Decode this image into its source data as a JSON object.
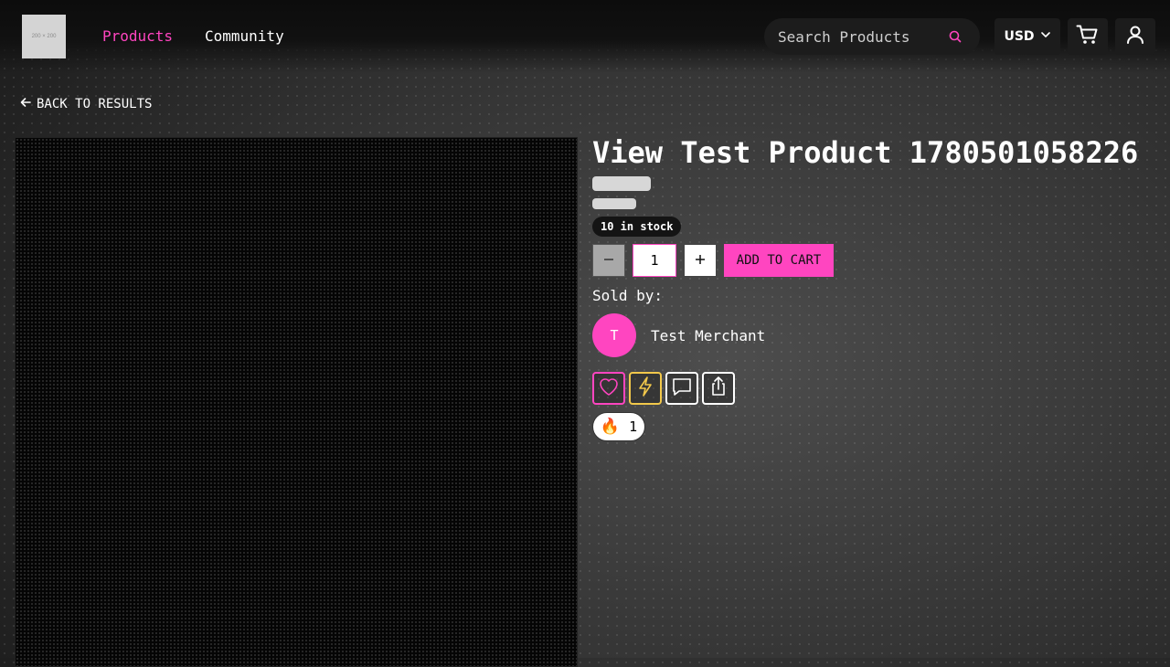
{
  "header": {
    "logo_text": "200 × 200",
    "nav": [
      {
        "label": "Products",
        "active": true
      },
      {
        "label": "Community",
        "active": false
      }
    ],
    "search": {
      "placeholder": "Search Products",
      "value": ""
    },
    "currency": "USD",
    "icons": {
      "search": "search-icon",
      "currency_caret": "chevron-down-icon",
      "cart": "cart-icon",
      "user": "user-icon"
    }
  },
  "back_link": {
    "label": "BACK TO RESULTS",
    "icon": "arrow-left-icon"
  },
  "product": {
    "title": "View Test Product 1780501058226",
    "stock_badge": "10 in stock",
    "quantity": "1",
    "add_to_cart_label": "ADD TO CART",
    "sold_by_label": "Sold by:",
    "merchant_initial": "T",
    "merchant_name": "Test Merchant",
    "reaction": {
      "emoji": "🔥",
      "count": "1"
    },
    "actions": [
      "heart-icon",
      "lightning-icon",
      "comment-icon",
      "share-icon"
    ]
  },
  "colors": {
    "accent": "#ff45c0",
    "boost": "#f2c84b",
    "header_bg": "#0c0c0c",
    "control_bg": "#1c1c1c"
  }
}
